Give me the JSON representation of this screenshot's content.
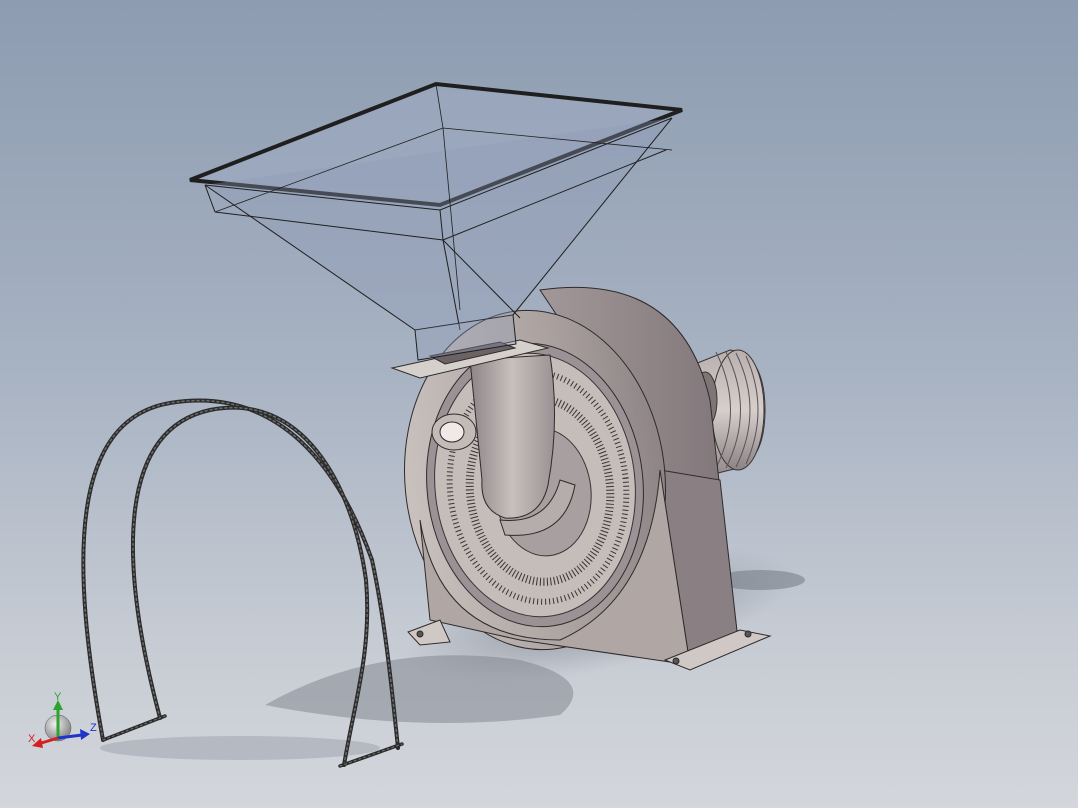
{
  "triad": {
    "x_label": "X",
    "y_label": "Y",
    "z_label": "Z",
    "x_color": "#d42020",
    "y_color": "#2ea32e",
    "z_color": "#2233c8"
  },
  "colors": {
    "background_top": "#8d9cb1",
    "background_bottom": "#d3d6db",
    "housing": "#b7aeaa",
    "hopper": "#9aa6bf",
    "edges": "#2a2a2a"
  },
  "icons": [
    "hopper-model",
    "grinder-housing-model",
    "motor-model",
    "u-bolt-model",
    "view-triad-icon"
  ]
}
